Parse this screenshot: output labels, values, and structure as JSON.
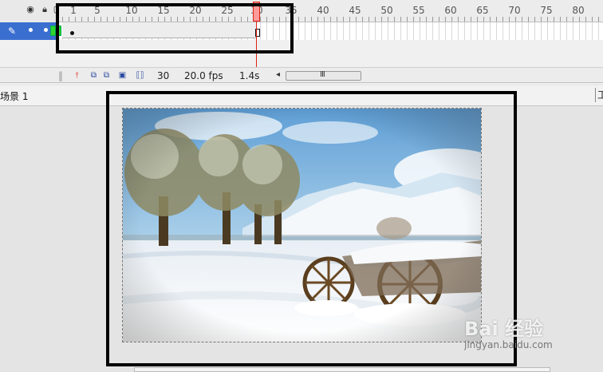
{
  "timeline": {
    "ruler_numbers": [
      "1",
      "5",
      "10",
      "15",
      "20",
      "25",
      "30",
      "35",
      "40",
      "45",
      "50",
      "55",
      "60",
      "65",
      "70",
      "75",
      "80"
    ],
    "icons": {
      "eye": "eye-icon",
      "lock": "lock-icon",
      "outline": "outline-square-icon",
      "pencil": "pencil-icon"
    },
    "playhead_frame": 30,
    "layer_color": "#3a6fd0",
    "keyframe_color": "#2fd42f"
  },
  "status": {
    "current_frame": "30",
    "frame_rate": "20.0 fps",
    "elapsed": "1.4s",
    "scroll_grip": "III"
  },
  "scene": {
    "label": "场景 1",
    "right_label": "工"
  },
  "watermark": {
    "main": "Bai 经验",
    "sub": "jingyan.baidu.com"
  }
}
